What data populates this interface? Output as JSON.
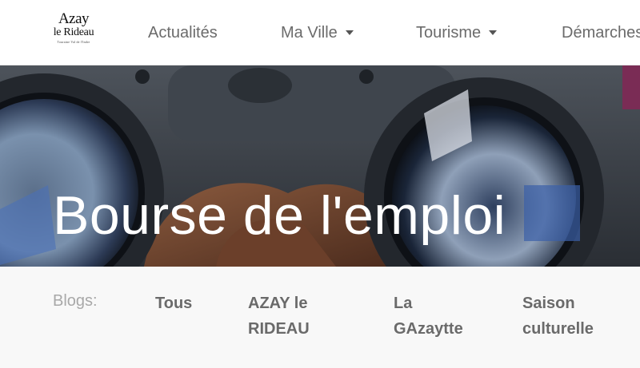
{
  "logo": {
    "line1": "Azay",
    "line2": "le Rideau",
    "tagline": "Touraine Val de l'Indre"
  },
  "nav": {
    "items": [
      {
        "label": "Actualités",
        "has_dropdown": false
      },
      {
        "label": "Ma Ville",
        "has_dropdown": true
      },
      {
        "label": "Tourisme",
        "has_dropdown": true
      },
      {
        "label": "Démarches",
        "has_dropdown": false
      }
    ]
  },
  "hero": {
    "title": "Bourse de l'emploi"
  },
  "blogs": {
    "label": "Blogs:",
    "links": [
      {
        "line1": "Tous",
        "line2": ""
      },
      {
        "line1": "AZAY le",
        "line2": "RIDEAU"
      },
      {
        "line1": "La",
        "line2": "GAzaytte"
      },
      {
        "line1": "Saison",
        "line2": "culturelle"
      }
    ]
  },
  "colors": {
    "topbar_bg": "#ffffff",
    "nav_text": "#6b6b6b",
    "hero_title": "#ffffff",
    "blogs_bg": "#f8f8f8",
    "blogs_label": "#a8a8a8",
    "blog_link": "#6a6a6a"
  }
}
